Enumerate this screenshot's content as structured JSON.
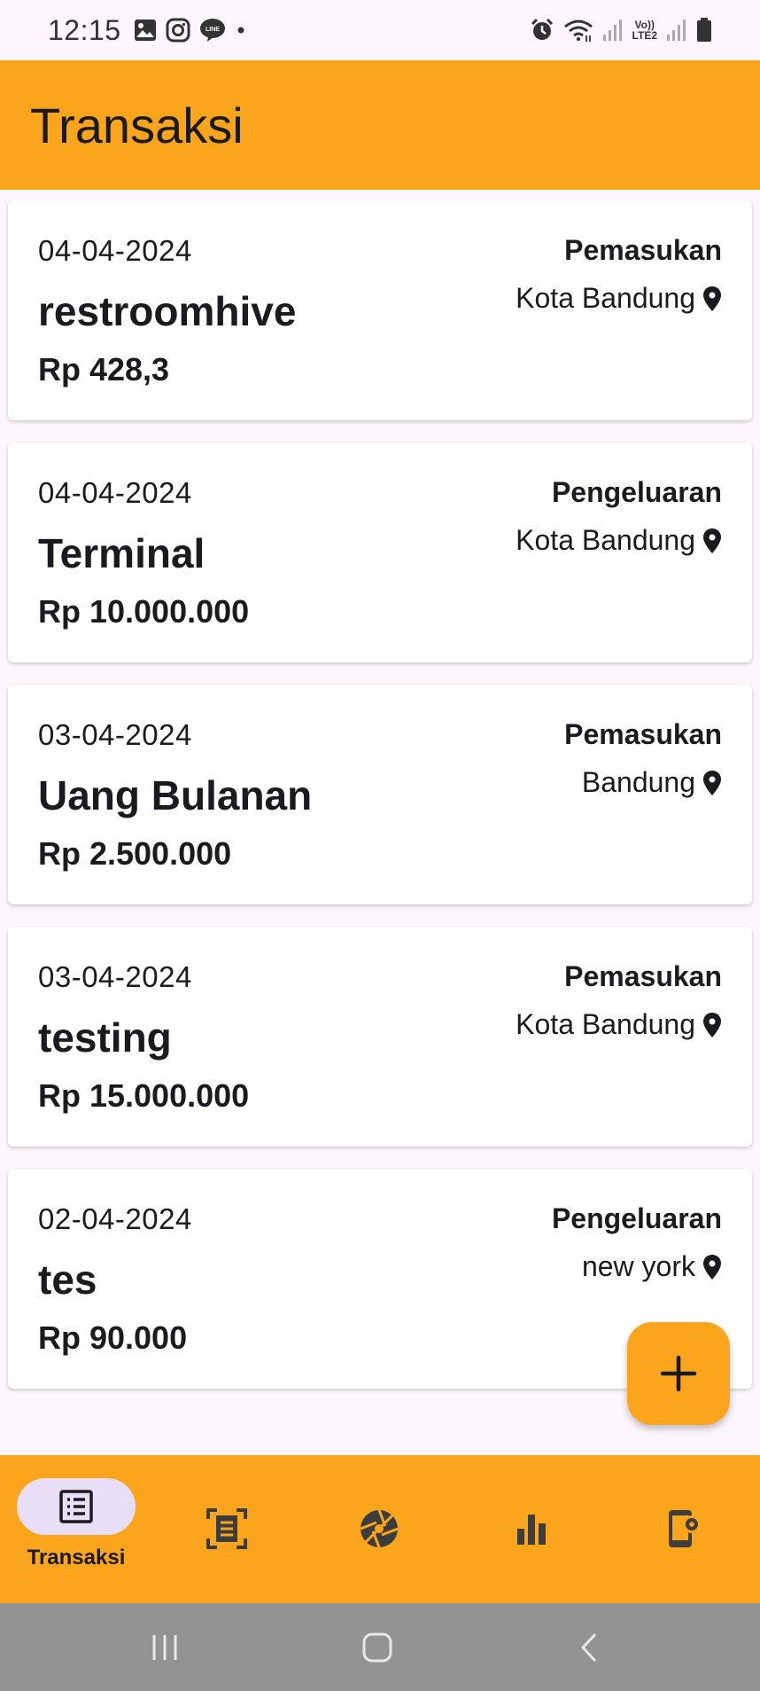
{
  "status_bar": {
    "time": "12:15",
    "lte_label_top": "Vo))",
    "lte_label_bottom": "LTE2"
  },
  "app_bar": {
    "title": "Transaksi"
  },
  "transactions": [
    {
      "date": "04-04-2024",
      "title": "restroomhive",
      "amount": "Rp 428,3",
      "type": "Pemasukan",
      "location": "Kota Bandung"
    },
    {
      "date": "04-04-2024",
      "title": "Terminal",
      "amount": "Rp 10.000.000",
      "type": "Pengeluaran",
      "location": "Kota Bandung"
    },
    {
      "date": "03-04-2024",
      "title": "Uang Bulanan",
      "amount": "Rp 2.500.000",
      "type": "Pemasukan",
      "location": "Bandung"
    },
    {
      "date": "03-04-2024",
      "title": "testing",
      "amount": "Rp 15.000.000",
      "type": "Pemasukan",
      "location": "Kota Bandung"
    },
    {
      "date": "02-04-2024",
      "title": "tes",
      "amount": "Rp 90.000",
      "type": "Pengeluaran",
      "location": "new york"
    }
  ],
  "fab": {
    "icon": "plus-icon"
  },
  "bottom_nav": {
    "items": [
      {
        "label": "Transaksi",
        "icon": "list-icon",
        "active": true
      },
      {
        "icon": "scan-receipt-icon",
        "active": false
      },
      {
        "icon": "camera-aperture-icon",
        "active": false
      },
      {
        "icon": "bar-chart-icon",
        "active": false
      },
      {
        "icon": "phone-settings-icon",
        "active": false
      }
    ]
  },
  "colors": {
    "primary": "#fba51c",
    "background": "#fdf7fd",
    "card": "#ffffff",
    "nav_active_pill": "#e8def8",
    "system_nav": "#959296"
  }
}
